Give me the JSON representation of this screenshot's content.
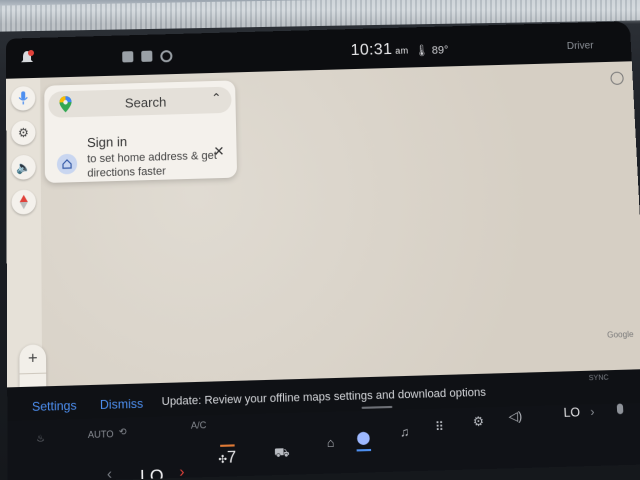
{
  "status_bar": {
    "time": "10:31",
    "ampm": "am",
    "temperature": "89",
    "temperature_unit": "°",
    "profile": "Driver"
  },
  "map": {
    "search_label": "Search",
    "sign_in_title": "Sign in",
    "sign_in_subtitle": "to set home address & get directions faster",
    "attribution": "Google",
    "zoom_in": "+",
    "zoom_out": "−"
  },
  "notification": {
    "settings_link": "Settings",
    "dismiss_link": "Dismiss",
    "message": "Update: Review your offline maps settings and download options"
  },
  "climate": {
    "auto_label": "AUTO",
    "ac_label": "A/C",
    "left_temp": "LO",
    "right_temp": "LO",
    "fan_speed": "7",
    "sync_label": "SYNC"
  },
  "colors": {
    "accent": "#4d8ff0",
    "heat_arrow": "#e0413a",
    "map_background": "#d9d3c9"
  },
  "icons": {
    "rail": [
      "mic-icon",
      "settings-gear-icon",
      "volume-icon",
      "compass-icon"
    ],
    "dock": [
      "home-icon",
      "maps-pin-icon",
      "music-note-icon",
      "app-grid-icon",
      "settings-gear-icon",
      "volume-icon"
    ]
  }
}
